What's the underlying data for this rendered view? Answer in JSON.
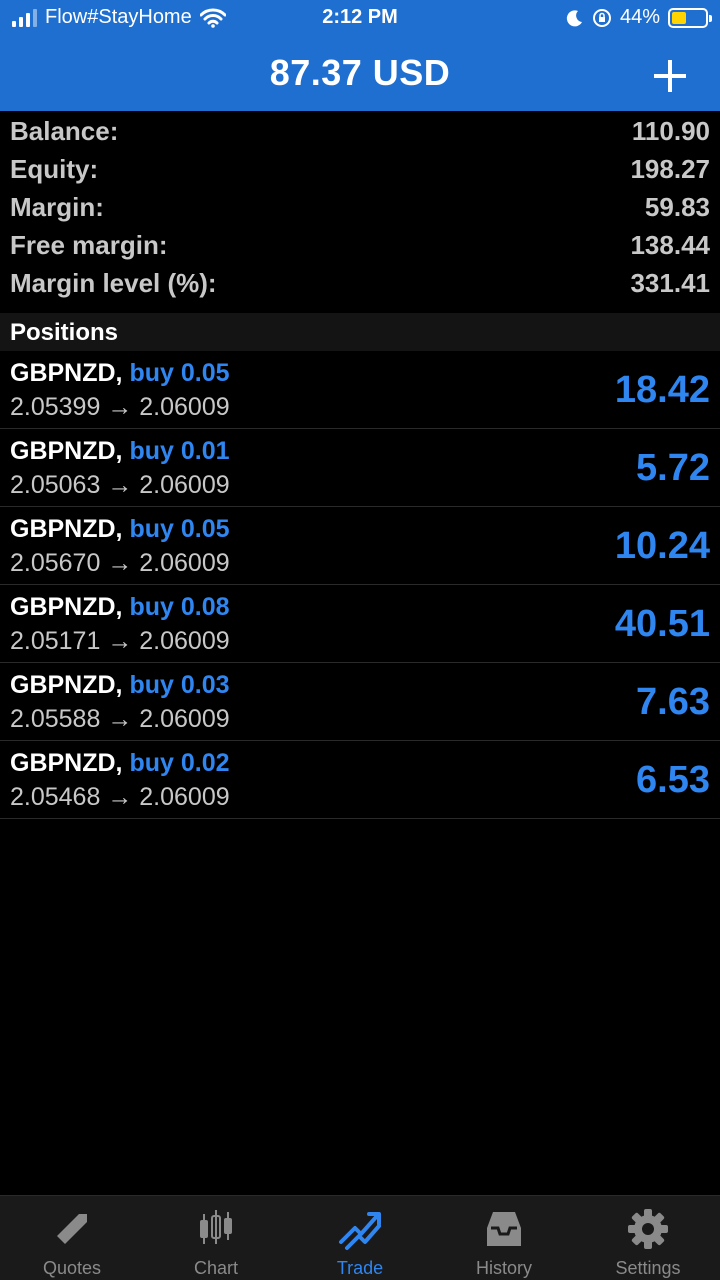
{
  "status_bar": {
    "carrier": "Flow#StayHome",
    "time": "2:12 PM",
    "battery": "44%",
    "battery_level": 0.44
  },
  "header": {
    "title": "87.37 USD"
  },
  "summary": [
    {
      "label": "Balance:",
      "value": "110.90"
    },
    {
      "label": "Equity:",
      "value": "198.27"
    },
    {
      "label": "Margin:",
      "value": "59.83"
    },
    {
      "label": "Free margin:",
      "value": "138.44"
    },
    {
      "label": "Margin level (%):",
      "value": "331.41"
    }
  ],
  "positions_header": "Positions",
  "positions": [
    {
      "symbol": "GBPNZD,",
      "side": "buy 0.05",
      "prices": "2.05399 → 2.06009",
      "profit": "18.42"
    },
    {
      "symbol": "GBPNZD,",
      "side": "buy 0.01",
      "prices": "2.05063 → 2.06009",
      "profit": "5.72"
    },
    {
      "symbol": "GBPNZD,",
      "side": "buy 0.05",
      "prices": "2.05670 → 2.06009",
      "profit": "10.24"
    },
    {
      "symbol": "GBPNZD,",
      "side": "buy 0.08",
      "prices": "2.05171 → 2.06009",
      "profit": "40.51"
    },
    {
      "symbol": "GBPNZD,",
      "side": "buy 0.03",
      "prices": "2.05588 → 2.06009",
      "profit": "7.63"
    },
    {
      "symbol": "GBPNZD,",
      "side": "buy 0.02",
      "prices": "2.05468 → 2.06009",
      "profit": "6.53"
    }
  ],
  "tabs": [
    {
      "label": "Quotes",
      "icon": "quotes-arrows-icon"
    },
    {
      "label": "Chart",
      "icon": "candlestick-chart-icon"
    },
    {
      "label": "Trade",
      "icon": "trade-trend-icon",
      "active": true
    },
    {
      "label": "History",
      "icon": "inbox-tray-icon"
    },
    {
      "label": "Settings",
      "icon": "gear-icon"
    }
  ],
  "colors": {
    "header_bg": "#1f6fd0",
    "accent": "#2f86f0",
    "battery_fill": "#ffd400"
  }
}
